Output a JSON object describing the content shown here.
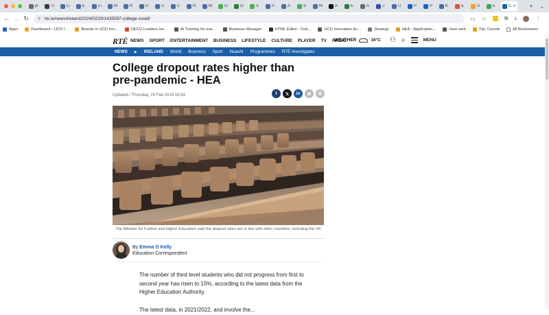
{
  "browser": {
    "tabs": [
      {
        "label": "pl",
        "color": "#6b6b6b"
      },
      {
        "label": "Ti",
        "color": "#3b3b3b"
      },
      {
        "label": "Li",
        "color": "#4a6fa5"
      },
      {
        "label": "E",
        "color": "#4a6fa5"
      },
      {
        "label": "Li",
        "color": "#4a6fa5"
      },
      {
        "label": "M",
        "color": "#4a6fa5"
      },
      {
        "label": "R",
        "color": "#4a6fa5"
      },
      {
        "label": "U",
        "color": "#4a6fa5"
      },
      {
        "label": "U",
        "color": "#4a6fa5"
      },
      {
        "label": "C",
        "color": "#4a6fa5"
      },
      {
        "label": "H",
        "color": "#4a6fa5"
      },
      {
        "label": "M",
        "color": "#4a6fa5"
      },
      {
        "label": "O",
        "color": "#4caf50"
      },
      {
        "label": "O",
        "color": "#2e7d32"
      },
      {
        "label": "S",
        "color": "#4caf50"
      },
      {
        "label": "P",
        "color": "#4a6fa5"
      },
      {
        "label": "A",
        "color": "#4a6fa5"
      },
      {
        "label": "S",
        "color": "#4caf50"
      },
      {
        "label": "M",
        "color": "#4a6fa5"
      },
      {
        "label": "A",
        "color": "#111111"
      },
      {
        "label": "E",
        "color": "#2e7d32"
      },
      {
        "label": "A",
        "color": "#6b6b6b"
      },
      {
        "label": "J",
        "color": "#3949ab"
      },
      {
        "label": "U",
        "color": "#4a6fa5"
      },
      {
        "label": "P",
        "color": "#1e63c4"
      },
      {
        "label": "P",
        "color": "#1e63c4"
      },
      {
        "label": "K",
        "color": "#4a6fa5"
      },
      {
        "label": "E",
        "color": "#e0523b"
      },
      {
        "label": "S",
        "color": "#f0a030"
      },
      {
        "label": "u",
        "color": "#34a853"
      },
      {
        "label": "C",
        "color": "#1a5ea8",
        "active": true
      }
    ],
    "url": "rte.ie/news/ireland/2024/0229/1435097-college-covid/",
    "bookmarks": [
      {
        "label": "Apps",
        "color": "#1e63c4"
      },
      {
        "label": "Dashboard ‹ UCD I...",
        "color": "#f0a030"
      },
      {
        "label": "Boards in UCD Inn...",
        "color": "#e0a020"
      },
      {
        "label": "OECD Leaders He...",
        "color": "#d9482b"
      },
      {
        "label": "AI Training for exe...",
        "color": "#555555"
      },
      {
        "label": "Business Manager",
        "color": "#555555"
      },
      {
        "label": "HTML Editor - Onli...",
        "color": "#333333"
      },
      {
        "label": "UCD Innovation Ac...",
        "color": "#555555"
      },
      {
        "label": "Strategy",
        "color": "#777777"
      },
      {
        "label": "HEA - Application...",
        "color": "#e0a020"
      },
      {
        "label": "User web",
        "color": "#555555"
      },
      {
        "label": "T&L Corner",
        "color": "#e0a020"
      }
    ],
    "all_bookmarks": "All Bookmarks"
  },
  "site": {
    "logo": "RTÉ",
    "nav": [
      "NEWS",
      "SPORT",
      "ENTERTAINMENT",
      "BUSINESS",
      "LIFESTYLE",
      "CULTURE",
      "PLAYER",
      "TV",
      "RADIO"
    ],
    "weather_label": "WEATHER",
    "temperature": "16°C",
    "menu_label": "MENU",
    "subnav": {
      "news": "NEWS",
      "ireland": "IRELAND",
      "items": [
        "World",
        "Business",
        "Sport",
        "Nuacht",
        "Programmes",
        "RTÉ Investigates"
      ]
    }
  },
  "article": {
    "headline": "College dropout rates higher than pre-pandemic - HEA",
    "updated": "Updated / Thursday, 29 Feb 2024 16:54",
    "caption": "The Minister for Further and Higher Education said the dropout rates are in line with other countries, including the UK",
    "author_by": "By",
    "author_name": "Emma O Kelly",
    "author_role": "Education Correspondent",
    "paragraph_1": "The number of third level students who did not progress from first to second year has risen to 15%, according to the latest data from the Higher Education Authority.",
    "paragraph_2": "The latest data, in 2021/2022, and involve the...",
    "share": [
      "facebook",
      "x",
      "linkedin",
      "email",
      "print"
    ]
  }
}
